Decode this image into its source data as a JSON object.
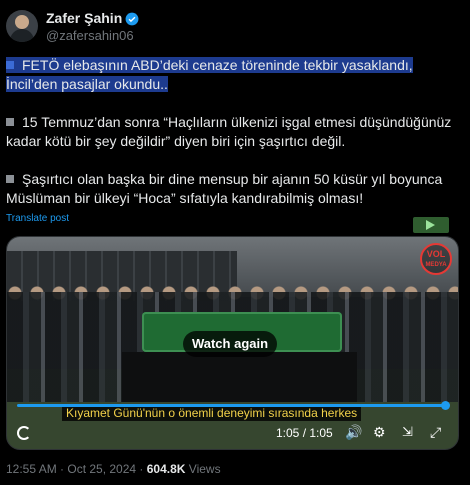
{
  "user": {
    "display_name": "Zafer Şahin",
    "handle": "@zafersahin06"
  },
  "tweet": {
    "line1a": "FETÖ elebaşının ABD’deki cenaze töreninde tekbir yasaklandı,",
    "line1b": "İncil’den pasajlar okundu..",
    "p2a": "15 Temmuz’dan sonra “Haçlıların ülkenizi işgal etmesi düşündüğünüz",
    "p2b": "kadar kötü bir şey değildir” diyen biri için şaşırtıcı değil.",
    "p3a": "Şaşırtıcı olan başka bir dine mensup bir ajanın 50 küsür yıl boyunca",
    "p3b": "Müslüman bir ülkeyi “Hoca” sıfatıyla kandırabilmiş olması!"
  },
  "translate_label": "Translate post",
  "video": {
    "watch_again": "Watch again",
    "subtitle": "Kıyamet Günü'nün o önemli deneyimi sırasında herkes",
    "time": "1:05 / 1:05",
    "logo": "VOL",
    "logo_sub": "MEDYA",
    "progress": 1.0
  },
  "footer": {
    "timestamp": "12:55 AM · Oct 25, 2024 · ",
    "views_count": "604.8K",
    "views_label": " Views"
  },
  "colors": {
    "accent": "#1d9bf0",
    "highlight": "#1d3b8f"
  }
}
